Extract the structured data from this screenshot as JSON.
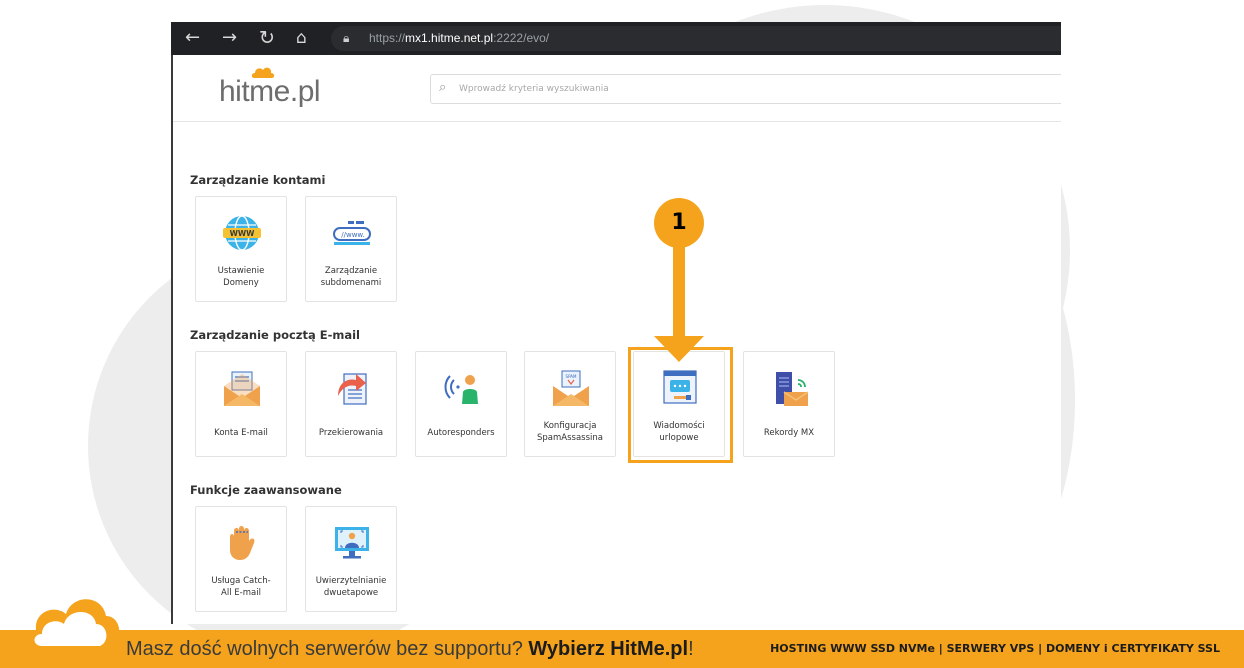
{
  "browser": {
    "url_prefix": "https://",
    "url_host": "mx1.hitme.net.pl",
    "url_rest": ":2222/evo/"
  },
  "header": {
    "logo_text": "hitme.pl",
    "search_placeholder": "Wprowadź kryteria wyszukiwania"
  },
  "sections": [
    {
      "title": "Zarządzanie kontami",
      "tiles": [
        {
          "label": "Ustawienie\nDomeny",
          "icon": "www-globe-icon"
        },
        {
          "label": "Zarządzanie\nsubdomenami",
          "icon": "www-address-icon"
        }
      ]
    },
    {
      "title": "Zarządzanie pocztą E-mail",
      "tiles": [
        {
          "label": "Konta E-mail",
          "icon": "envelope-icon"
        },
        {
          "label": "Przekierowania",
          "icon": "forward-document-icon"
        },
        {
          "label": "Autoresponders",
          "icon": "person-signal-icon"
        },
        {
          "label": "Konfiguracja\nSpamAssassina",
          "icon": "spam-envelope-icon"
        },
        {
          "label": "Wiadomości\nurlopowe",
          "icon": "vacation-message-icon"
        },
        {
          "label": "Rekordy MX",
          "icon": "mx-server-icon"
        }
      ]
    },
    {
      "title": "Funkcje zaawansowane",
      "tiles": [
        {
          "label": "Usługa Catch-\nAll E-mail",
          "icon": "hand-catch-icon"
        },
        {
          "label": "Uwierzytelnianie\ndwuetapowe",
          "icon": "two-factor-monitor-icon"
        }
      ]
    }
  ],
  "callout": {
    "number": "1"
  },
  "footer": {
    "text_plain": "Masz dość wolnych serwerów bez supportu? ",
    "text_bold": "Wybierz HitMe.pl",
    "text_end": "!",
    "services": "HOSTING WWW SSD NVMe | SERWERY VPS | DOMENY i CERTYFIKATY SSL"
  },
  "colors": {
    "accent": "#f5a31c"
  }
}
